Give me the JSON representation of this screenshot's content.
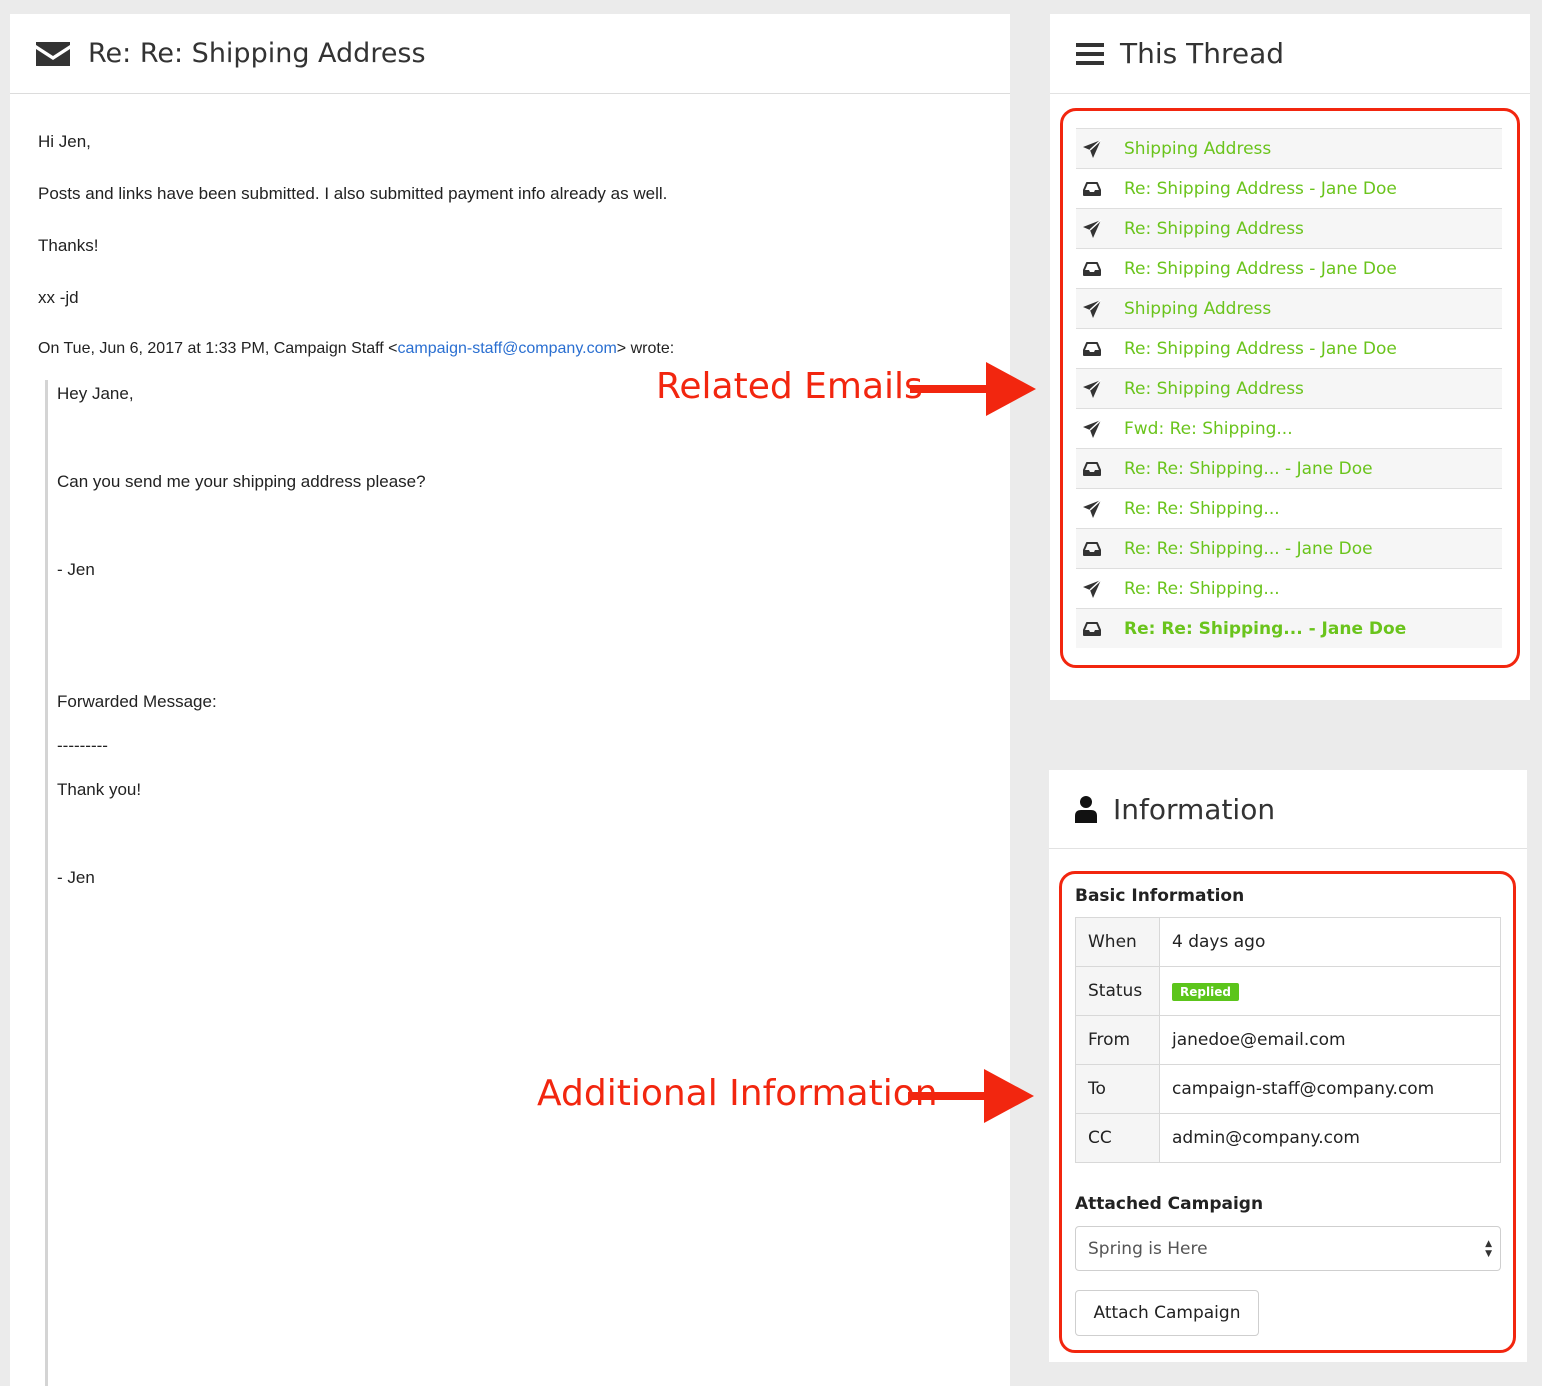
{
  "email": {
    "icon": "envelope-icon",
    "subject": "Re: Re: Shipping Address",
    "greeting": "Hi Jen,",
    "line1": "Posts and links have been submitted. I also submitted payment info already as well.",
    "thanks": "Thanks!",
    "signoff": "xx -jd",
    "quote_intro_prefix": "On Tue, Jun 6, 2017 at 1:33 PM,",
    "quote_sender": "Campaign Staff <",
    "quote_email": "campaign-staff@company.com",
    "quote_suffix": "> wrote:",
    "quoted": {
      "greeting": "Hey Jane,",
      "question": "Can you send me your shipping address please?",
      "sign1": "- Jen",
      "forwarded_label": "Forwarded Message:",
      "divider": "---------",
      "thank_you": "Thank you!",
      "sign2": "- Jen"
    }
  },
  "thread": {
    "icon": "list-icon",
    "title": "This Thread",
    "items": [
      {
        "type": "sent",
        "label": "Shipping Address"
      },
      {
        "type": "inbox",
        "label": "Re: Shipping Address - Jane Doe"
      },
      {
        "type": "sent",
        "label": "Re: Shipping Address"
      },
      {
        "type": "inbox",
        "label": "Re: Shipping Address - Jane Doe"
      },
      {
        "type": "sent",
        "label": "Shipping Address"
      },
      {
        "type": "inbox",
        "label": "Re: Shipping Address - Jane Doe"
      },
      {
        "type": "sent",
        "label": "Re: Shipping Address"
      },
      {
        "type": "sent",
        "label": "Fwd: Re: Shipping..."
      },
      {
        "type": "inbox",
        "label": "Re: Re: Shipping... - Jane Doe"
      },
      {
        "type": "sent",
        "label": "Re: Re: Shipping..."
      },
      {
        "type": "inbox",
        "label": "Re: Re: Shipping... - Jane Doe"
      },
      {
        "type": "sent",
        "label": "Re: Re: Shipping..."
      },
      {
        "type": "inbox",
        "label": "Re: Re: Shipping... - Jane Doe",
        "current": true
      }
    ]
  },
  "info": {
    "icon": "user-icon",
    "title": "Information",
    "basic_title": "Basic Information",
    "rows": {
      "when_key": "When",
      "when_val": "4 days ago",
      "status_key": "Status",
      "status_val": "Replied",
      "from_key": "From",
      "from_val": "janedoe@email.com",
      "to_key": "To",
      "to_val": "campaign-staff@company.com",
      "cc_key": "CC",
      "cc_val": "admin@company.com"
    },
    "campaign_title": "Attached Campaign",
    "campaign_selected": "Spring is Here",
    "attach_button": "Attach Campaign"
  },
  "annotations": {
    "related": "Related Emails",
    "additional": "Additional Information"
  },
  "colors": {
    "accent_green": "#6ac41c",
    "badge_green": "#5cc51b",
    "annotation_red": "#f2260f",
    "link_blue": "#2a6fd1"
  }
}
